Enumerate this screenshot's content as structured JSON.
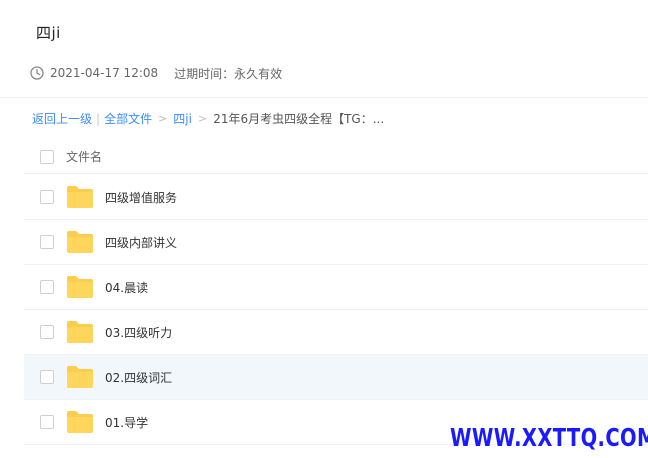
{
  "share": {
    "title": "四ji",
    "date": "2021-04-17 12:08",
    "expire_label": "过期时间：",
    "expire_value": "永久有效"
  },
  "breadcrumb": {
    "back": "返回上一级",
    "all_files": "全部文件",
    "parent": "四ji",
    "current": "21年6月考虫四级全程【TG：..."
  },
  "list": {
    "header_label": "文件名",
    "items": [
      {
        "name": "四级增值服务",
        "icon": "folder-icon"
      },
      {
        "name": "四级内部讲义",
        "icon": "folder-icon"
      },
      {
        "name": "04.晨读",
        "icon": "folder-icon"
      },
      {
        "name": "03.四级听力",
        "icon": "folder-icon"
      },
      {
        "name": "02.四级词汇",
        "icon": "folder-icon"
      },
      {
        "name": "01.导学",
        "icon": "folder-icon"
      }
    ]
  },
  "watermark": "WWW.XXTTQ.COM",
  "colors": {
    "link": "#3b8cff",
    "folder": "#ffcd4d",
    "row_hover": "#f2f7fc",
    "watermark": "#1a1aff"
  }
}
